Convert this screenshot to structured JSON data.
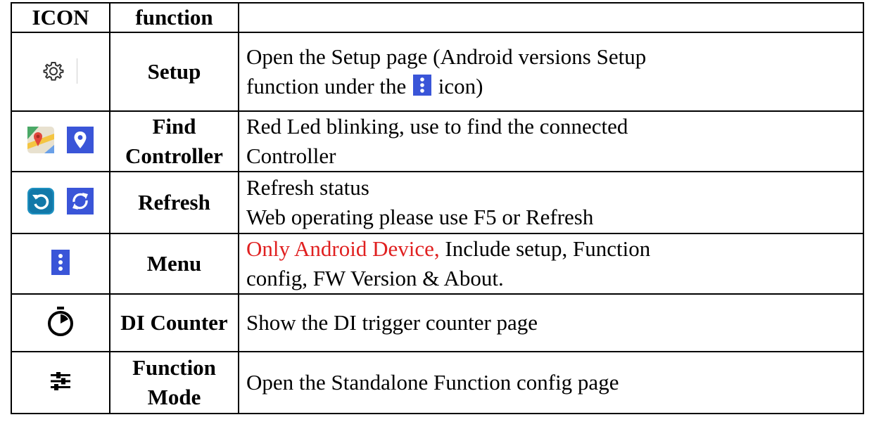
{
  "header": {
    "icon": "ICON",
    "function": "function",
    "description": ""
  },
  "rows": [
    {
      "icons": [
        "gear-icon"
      ],
      "function": "Setup",
      "desc_line1": "Open the Setup page (Android versions Setup",
      "desc_line2_before": "function under the",
      "desc_inline_icon": "menu-dots-icon",
      "desc_line2_after": "icon)"
    },
    {
      "icons": [
        "maps-icon",
        "location-pin-icon"
      ],
      "function_line1": "Find",
      "function_line2": "Controller",
      "desc_line1": "Red Led blinking, use to find the connected",
      "desc_line2": "Controller"
    },
    {
      "icons": [
        "refresh-rounded-icon",
        "refresh-arrows-icon"
      ],
      "function": "Refresh",
      "desc_line1": "Refresh status",
      "desc_line2": "Web operating please use F5 or Refresh"
    },
    {
      "icons": [
        "menu-dots-icon"
      ],
      "function": "Menu",
      "desc_red": "Only Android Device,",
      "desc_line1_rest": " Include setup, Function",
      "desc_line2": "config, FW Version & About."
    },
    {
      "icons": [
        "stopwatch-icon"
      ],
      "function": "DI Counter",
      "desc": "Show the DI trigger counter page"
    },
    {
      "icons": [
        "sliders-icon"
      ],
      "function_line1": "Function",
      "function_line2": "Mode",
      "desc": "Open the Standalone Function config page"
    }
  ],
  "colors": {
    "highlight_red": "#e02020",
    "icon_blue": "#3a55d8",
    "refresh_teal": "#1e90c0"
  }
}
